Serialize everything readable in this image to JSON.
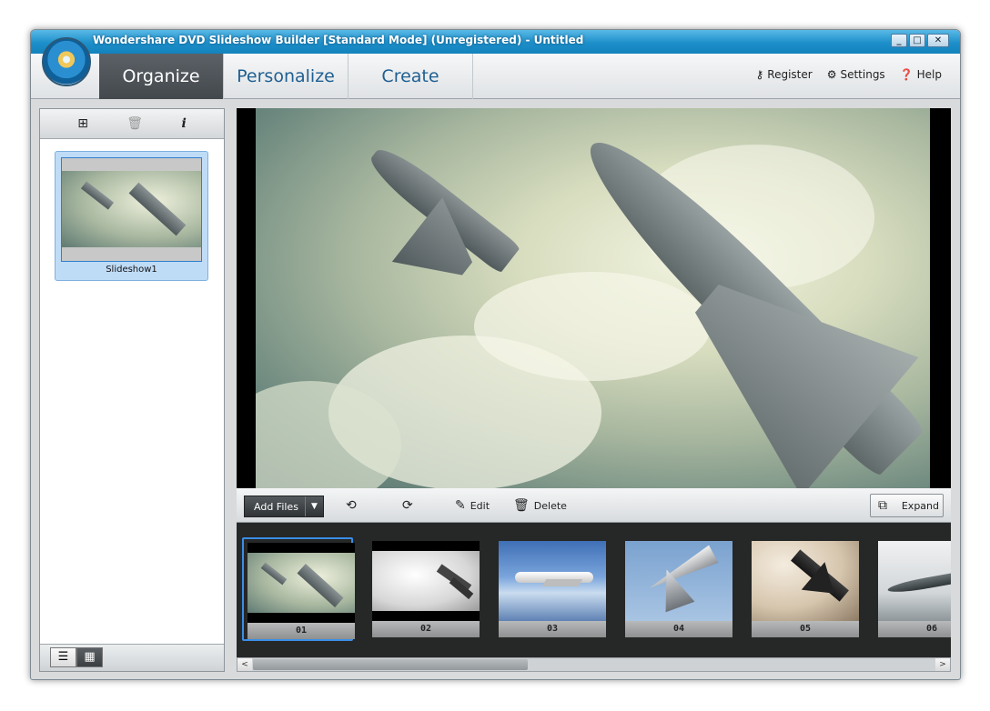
{
  "window": {
    "title": "Wondershare DVD Slideshow Builder [Standard Mode] (Unregistered) - Untitled",
    "controls": [
      "_",
      "□",
      "✕"
    ]
  },
  "nav": {
    "tabs": [
      {
        "label": "Organize",
        "active": true
      },
      {
        "label": "Personalize",
        "active": false
      },
      {
        "label": "Create",
        "active": false
      }
    ],
    "links": [
      {
        "label": "Register",
        "icon": "key-icon"
      },
      {
        "label": "Settings",
        "icon": "gear-icon"
      },
      {
        "label": "Help",
        "icon": "help-icon"
      }
    ]
  },
  "left_panel": {
    "toolbar": {
      "add_icon": "add-slideshow-icon",
      "delete_icon": "trash-icon",
      "info_icon": "info-icon"
    },
    "slideshows": [
      {
        "label": "Slideshow1"
      }
    ],
    "view_modes": [
      "list-view-icon",
      "thumbnail-view-icon"
    ]
  },
  "edit_toolbar": {
    "add_files_label": "Add Files",
    "rotate_left_icon": "rotate-left-icon",
    "rotate_right_icon": "rotate-right-icon",
    "edit_label": "Edit",
    "delete_label": "Delete",
    "expand_label": "Expand"
  },
  "filmstrip": {
    "items": [
      {
        "label": "01",
        "selected": true,
        "theme": "jets-clouds"
      },
      {
        "label": "02",
        "selected": false,
        "theme": "jets-bw"
      },
      {
        "label": "03",
        "selected": false,
        "theme": "airliner-sky"
      },
      {
        "label": "04",
        "selected": false,
        "theme": "fighter-blue"
      },
      {
        "label": "05",
        "selected": false,
        "theme": "jet-sepia"
      },
      {
        "label": "06",
        "selected": false,
        "theme": "jet-ground"
      }
    ]
  },
  "colors": {
    "titlebar": "#1d8fc9",
    "active_tab": "#43484d",
    "tab_text": "#1f5f91",
    "selection": "#3a8ee6",
    "filmstrip_bg": "#262727"
  }
}
